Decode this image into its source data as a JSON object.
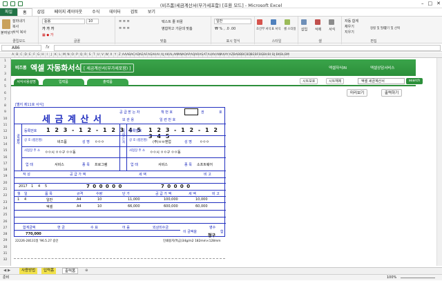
{
  "window": {
    "title": "(비즈폼)세금계산서(부가세포함) [호환 모드] - Microsoft Excel"
  },
  "ribbon_tabs": [
    "파일",
    "홈",
    "삽입",
    "페이지 레이아웃",
    "수식",
    "데이터",
    "검토",
    "보기"
  ],
  "ribbon": {
    "paste": "붙여넣기",
    "cut": "잘라내기",
    "copy": "복사",
    "format_painter": "서식 복사",
    "clipboard": "클립보드",
    "font_name": "돋움",
    "font_size": "10",
    "font": "글꼴",
    "wrap_text": "텍스트 줄 바꿈",
    "merge_center": "병합하고 가운데 맞춤",
    "alignment": "맞춤",
    "number_format": "일반",
    "number": "표시 형식",
    "cond_format": "조건부 서식",
    "table_format": "표 서식",
    "cell_style": "셀 스타일",
    "styles": "스타일",
    "insert": "삽입",
    "delete": "삭제",
    "format": "서식",
    "cells": "셀",
    "autosum": "자동 합계",
    "fill": "채우기",
    "clear": "지우기",
    "sort_filter": "정렬 및 필터",
    "find_select": "찾기 및 선택",
    "editing": "편집"
  },
  "formula_bar": {
    "name_box": "A86",
    "fx": "fx",
    "formula": ""
  },
  "columns": [
    "A",
    "B",
    "C",
    "D",
    "E",
    "F",
    "G",
    "H",
    "I",
    "J",
    "K",
    "L",
    "M",
    "N",
    "O",
    "P",
    "Q",
    "R",
    "S",
    "T",
    "U",
    "V",
    "W",
    "X",
    "Y",
    "Z",
    "AA",
    "AB",
    "AC",
    "AD",
    "AE",
    "AF",
    "AG",
    "AH",
    "AI",
    "AJ",
    "AK",
    "AL",
    "AM",
    "AN",
    "AO",
    "AP",
    "AQ",
    "AR",
    "AS",
    "AT",
    "AU",
    "AV",
    "AW",
    "AX",
    "AY",
    "AZ",
    "BA",
    "BB",
    "BC",
    "BD",
    "BE",
    "BF",
    "BG",
    "BH",
    "BI",
    "BJ",
    "BK",
    "BL",
    "BM"
  ],
  "rows": [
    "1",
    "2",
    "3",
    "4",
    "5",
    "6",
    "7",
    "8",
    "9",
    "10",
    "11",
    "12",
    "13",
    "14",
    "15",
    "16",
    "17",
    "18",
    "19",
    "20",
    "21",
    "22",
    "23",
    "24",
    "25",
    "26",
    "27",
    "28",
    "29",
    "30",
    "31",
    "32"
  ],
  "banner": {
    "brand": "비즈폼",
    "app_title": "엑셀 자동화서식",
    "subtitle": "[ 세금계산서(부가세포함) ]",
    "nav1": "엑셀자식IN",
    "nav2": "엑셀상담서비스"
  },
  "tabs": {
    "t1": "서식사용설명",
    "t2": "입력폼",
    "t3": "출력폼"
  },
  "toolbar": {
    "save_a": "시트보호",
    "save_b": "시트해제",
    "search_placeholder": "엑셀 세금계산서",
    "search_btn": "search",
    "preview": "미리보기",
    "print": "출력하기"
  },
  "invoice": {
    "form_no": "[별지 제11호 서식]",
    "title": "세 금 계 산 서",
    "recv_label1": "공 급 받 는 자",
    "recv_label2": "보 관 용",
    "book_no": "책 번 호",
    "serial": "일 련 번 호",
    "gwon": "권",
    "ho": "호",
    "supplier": "공급자",
    "receiver": "공급받는자",
    "reg_no": "등록번호",
    "sup_reg": "1 2 3 - 1 2 - 1 2 3 4 5",
    "rcv_reg": "1 2 3 - 1 2 - 1 2 3 4 5",
    "trade_name": "상 호 (법인명)",
    "sup_name": "비즈폼",
    "name_label": "성 명",
    "sup_person": "ㅇㅇㅇ",
    "rcv_name": "(주)ㅂㅂ엔업",
    "rcv_person": "ㅇㅇㅇ",
    "addr_label": "사업장 주 소",
    "sup_addr": "ㅇㅇ시 ㅇㅇ구 ㅇㅇ동",
    "rcv_addr": "ㅇㅇ시 ㅇㅇ구 ㅇㅇ동",
    "biz_type": "업 태",
    "sup_type": "서비스",
    "item_label": "종 목",
    "sup_item": "프로그램",
    "rcv_type": "서비스",
    "rcv_item": "소프트웨어",
    "write_label": "작 성",
    "supply_label": "공 급 가 액",
    "tax_label": "세 액",
    "note_label": "비 고",
    "year": "2017",
    "month": "1",
    "day": "4",
    "blank": "5",
    "supply_total": "7 0 0 0 0 0",
    "tax_total": "7 0 0 0 0",
    "col_month": "월",
    "col_day": "일",
    "col_item": "품 목",
    "col_spec": "규격",
    "col_qty": "수량",
    "col_price": "단 가",
    "col_supply": "공 급 가 액",
    "col_tax": "세 액",
    "col_note": "비 고",
    "line1": {
      "m": "1",
      "d": "4",
      "item": "일반",
      "spec": "A4",
      "qty": "10",
      "price": "11,000",
      "supply": "100,000",
      "tax": "10,000"
    },
    "line2": {
      "item": "액셀",
      "spec": "A4",
      "qty": "10",
      "price": "66,000",
      "supply": "600,000",
      "tax": "60,000"
    },
    "sum_label": "합계금액",
    "cash": "현 금",
    "check": "수 표",
    "note": "어 음",
    "credit": "외상미수금",
    "claim_text": "이 금액을",
    "claim_a": "영수",
    "claim_b": "청구",
    "claim_c": "함",
    "sum_value": "770,000",
    "footer_left": "22226-28131일 '96.5.27 승인",
    "footer_right": "인쇄용지(특급)34g/m2 182mm×128mm"
  },
  "sheets": [
    "사용방법",
    "입력폼",
    "출력폼"
  ],
  "status": {
    "ready": "준비",
    "zoom": "100%"
  }
}
